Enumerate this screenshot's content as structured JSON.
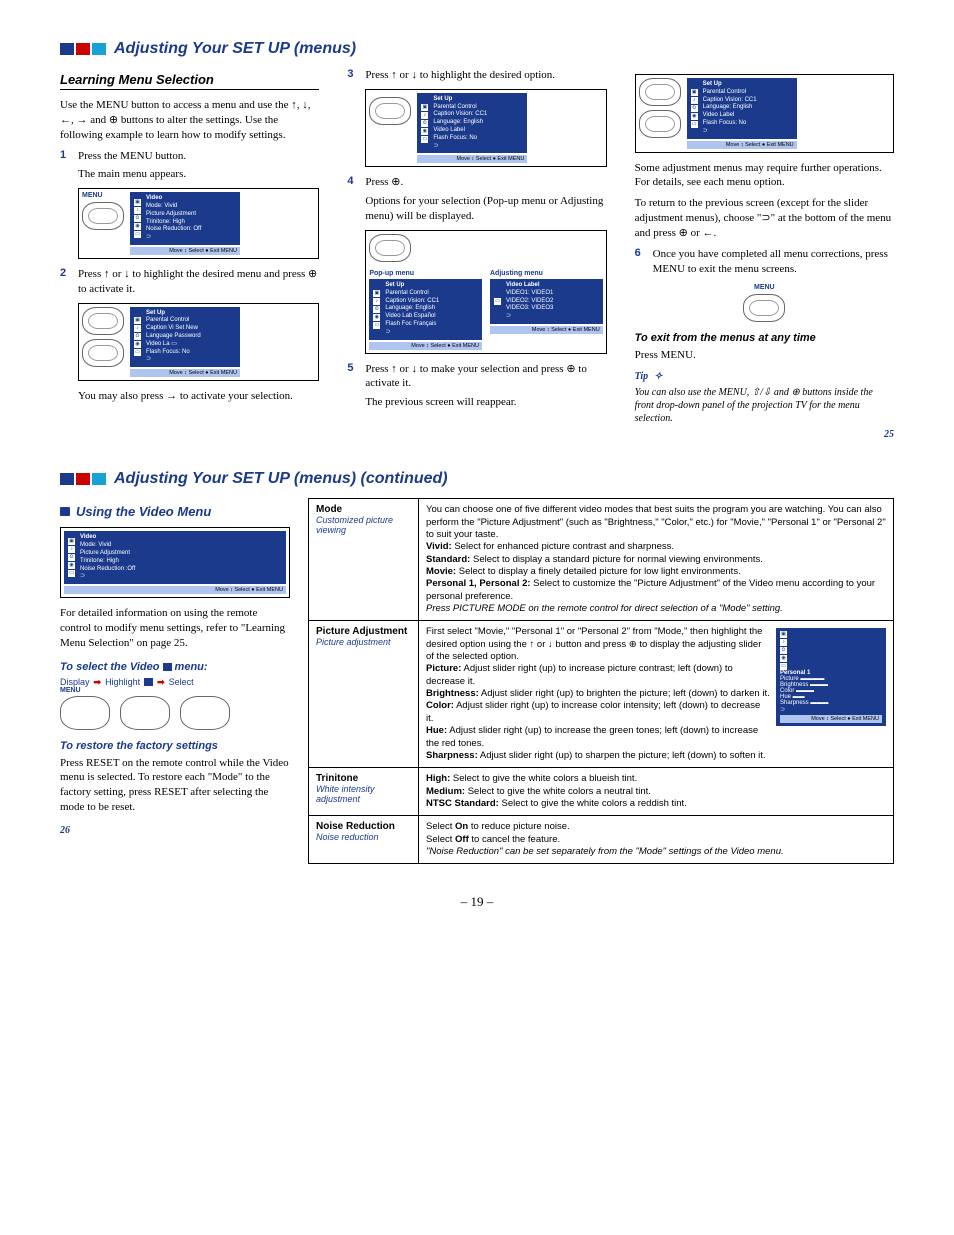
{
  "page25": {
    "heading": "Adjusting Your SET UP (menus)",
    "col1": {
      "subhead": "Learning Menu Selection",
      "intro": "Use the MENU button to access a menu and use the ↑, ↓, ←, → and ⊕ buttons to alter the settings. Use the following example to learn how to modify settings.",
      "steps": [
        {
          "num": "1",
          "text": "Press the MENU button."
        },
        {
          "indent": "The main menu appears."
        }
      ],
      "fig1_label": "MENU",
      "osd1": {
        "title": "Video",
        "lines": [
          "Mode:           Vivid",
          "Picture Adjustment",
          "Trinitone:      High",
          "Noise Reduction: Off",
          "⊃"
        ],
        "footer": "Move ↕   Select ●   Exit  MENU"
      },
      "step2": {
        "num": "2",
        "text": "Press ↑ or ↓ to highlight the desired menu and press ⊕ to activate it."
      },
      "osd2": {
        "title": "Set Up",
        "lines": [
          "Parental Control",
          "Caption Vi Set New",
          "Language  Password",
          "Video La  ▭",
          "Flash Focus:    No",
          "⊃"
        ],
        "footer": "Move ↕   Select ●   Exit  MENU"
      },
      "step2_tail": "You may also press → to activate your selection."
    },
    "col2": {
      "step3": {
        "num": "3",
        "text": "Press ↑ or ↓ to highlight the desired option."
      },
      "osd3": {
        "title": "Set Up",
        "lines": [
          "Parental Control",
          "Caption Vision: CC1",
          "Language:   English",
          "Video Label",
          "Flash Focus:    No",
          "⊃"
        ],
        "footer": "Move ↕   Select ●   Exit  MENU"
      },
      "step4": {
        "num": "4",
        "text": "Press ⊕."
      },
      "step4_tail": "Options for your selection (Pop-up menu or Adjusting menu) will be displayed.",
      "popup_label": "Pop-up menu",
      "adjust_label": "Adjusting menu",
      "osd4a": {
        "title": "Set Up",
        "lines": [
          "Parental Control",
          "Caption Vision: CC1",
          "Language:  English",
          "Video Lab  Español",
          "Flash Foc  Français",
          "⊃"
        ],
        "footer": "Move ↕   Select ●   Exit  MENU"
      },
      "osd4b": {
        "title": "Video Label",
        "lines": [
          "VIDEO1:     VIDEO1",
          "VIDEO2:     VIDEO2",
          "VIDEO3:     VIDEO3",
          "⊃"
        ],
        "footer": "Move ↕   Select ●   Exit  MENU"
      },
      "step5": {
        "num": "5",
        "text": "Press ↑ or ↓ to make your selection and press ⊕ to activate it."
      },
      "step5_tail": "The previous screen will reappear."
    },
    "col3": {
      "osd5": {
        "title": "Set Up",
        "lines": [
          "Parental Control",
          "Caption Vision: CC1",
          "Language:   English",
          "Video Label",
          "Flash Focus:    No",
          "⊃"
        ],
        "footer": "Move ↕   Select ●   Exit  MENU"
      },
      "para1": "Some adjustment menus may require further operations. For details, see each menu option.",
      "para2a": "To return to the previous screen (except for the slider adjustment menus), choose \"",
      "para2b": "\" at the bottom of the menu and press ⊕ or ←.",
      "step6": {
        "num": "6",
        "text": "Once you have completed all menu corrections, press MENU to exit the menu screens."
      },
      "menu_label": "MENU",
      "exit_head": "To exit from the menus at any time",
      "exit_body": "Press MENU.",
      "tip_label": "Tip",
      "tip_text": "You can also use the MENU, ⇧/⇩ and ⊕ buttons inside the front drop-down panel of the projection TV for the menu selection.",
      "page": "25"
    }
  },
  "page26": {
    "heading": "Adjusting Your SET UP (menus) (continued)",
    "left": {
      "subhead": "Using the Video Menu",
      "osd": {
        "title": "Video",
        "lines": [
          "Mode:          Vivid",
          "Picture Adjustment",
          "Trinitone:     High",
          "Noise Reduction :Off",
          "⊃"
        ],
        "footer": "Move ↕   Select ●   Exit  MENU"
      },
      "para": "For detailed information on using the remote control to modify menu settings, refer to \"Learning Menu Selection\" on page 25.",
      "select_head_a": "To select the Video ",
      "select_head_b": " menu:",
      "flow": [
        "Display",
        "Highlight",
        "Select"
      ],
      "restore_head": "To restore the factory settings",
      "restore_body": "Press RESET on the remote control while the Video menu is selected. To restore each \"Mode\" to the factory setting, press RESET after selecting the mode to be reset.",
      "page": "26"
    },
    "table": {
      "rows": [
        {
          "title": "Mode",
          "sub": "Customized picture viewing",
          "body_lines": [
            "You can choose one of five different video modes that best suits the program you are watching. You can also perform the \"Picture Adjustment\" (such as \"Brightness,\" \"Color,\" etc.) for \"Movie,\" \"Personal 1\" or \"Personal 2\" to suit your taste.",
            "<b>Vivid:</b> Select for enhanced picture contrast and sharpness.",
            "<b>Standard:</b> Select to display a standard picture for normal viewing environments.",
            "<b>Movie:</b> Select to display a finely detailed picture for low light environments.",
            "<b>Personal 1, Personal 2:</b> Select to customize the \"Picture Adjustment\" of the Video menu according to your personal preference.",
            "<i>Press PICTURE MODE on the remote control for direct selection of a \"Mode\" setting.</i>"
          ]
        },
        {
          "title": "Picture Adjustment",
          "sub": "Picture adjustment",
          "body_lines": [
            "First select \"Movie,\" \"Personal 1\" or \"Personal 2\" from \"Mode,\" then highlight the desired option using the ↑ or ↓ button and press ⊕ to display the adjusting slider of the selected option.",
            "<b>Picture:</b> Adjust slider right (up) to increase picture contrast;  left (down) to decrease it.",
            "<b>Brightness:</b> Adjust slider right (up) to brighten the picture;  left (down) to darken it.",
            "<b>Color:</b> Adjust slider right (up) to increase color intensity;  left (down) to decrease it.",
            "<b>Hue:</b> Adjust slider right (up) to increase the green tones; left (down) to increase the red tones.",
            "<b>Sharpness:</b> Adjust slider right (up) to sharpen the picture; left (down) to soften it."
          ],
          "mini_osd": {
            "title": "Personal 1",
            "lines": [
              "Picture    ▬▬▬▬",
              "Brightness ▬▬▬",
              "Color      ▬▬▬",
              "Hue        ▬▬",
              "Sharpness  ▬▬▬",
              "⊃"
            ],
            "footer": "Move ↕   Select ●   Exit  MENU"
          }
        },
        {
          "title": "Trinitone",
          "sub": "White intensity adjustment",
          "body_lines": [
            "<b>High:</b> Select to give the white colors a blueish tint.",
            "<b>Medium:</b> Select to give the white colors a neutral tint.",
            "<b>NTSC Standard:</b> Select to give the white colors a reddish tint."
          ]
        },
        {
          "title": "Noise Reduction",
          "sub": "Noise reduction",
          "body_lines": [
            "Select <b>On</b> to reduce picture noise.",
            "Select <b>Off</b> to cancel the feature.",
            "<i>\"Noise Reduction\" can be set separately from the \"Mode\" settings of the Video menu.</i>"
          ]
        }
      ]
    }
  },
  "footer_page": "– 19 –"
}
